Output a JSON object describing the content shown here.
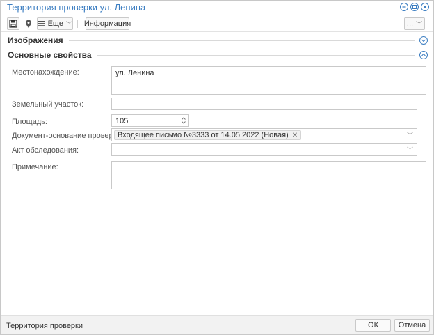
{
  "window": {
    "title": "Территория проверки ул. Ленина"
  },
  "toolbar": {
    "save_icon": "save-icon",
    "location_icon": "map-pin-icon",
    "more_label": "Еще",
    "info_label": "Информация",
    "overflow_label": "..."
  },
  "sections": {
    "images": {
      "title": "Изображения",
      "state": "collapsed"
    },
    "main": {
      "title": "Основные свойства",
      "state": "expanded"
    }
  },
  "form": {
    "location": {
      "label": "Местонахождение:",
      "value": "ул. Ленина"
    },
    "land_plot": {
      "label": "Земельный участок:",
      "value": ""
    },
    "area": {
      "label": "Площадь:",
      "value": "105"
    },
    "basis_document": {
      "label": "Документ-основание проверки:",
      "tag": "Входящее письмо №3333 от 14.05.2022 (Новая)"
    },
    "inspection_act": {
      "label": "Акт обследования:",
      "value": ""
    },
    "note": {
      "label": "Примечание:",
      "value": ""
    }
  },
  "footer": {
    "title": "Территория проверки",
    "ok_label": "ОК",
    "cancel_label": "Отмена"
  },
  "colors": {
    "accent": "#3b7dc1",
    "border": "#c9c9c9",
    "footer_bg": "#f2f2f2"
  }
}
